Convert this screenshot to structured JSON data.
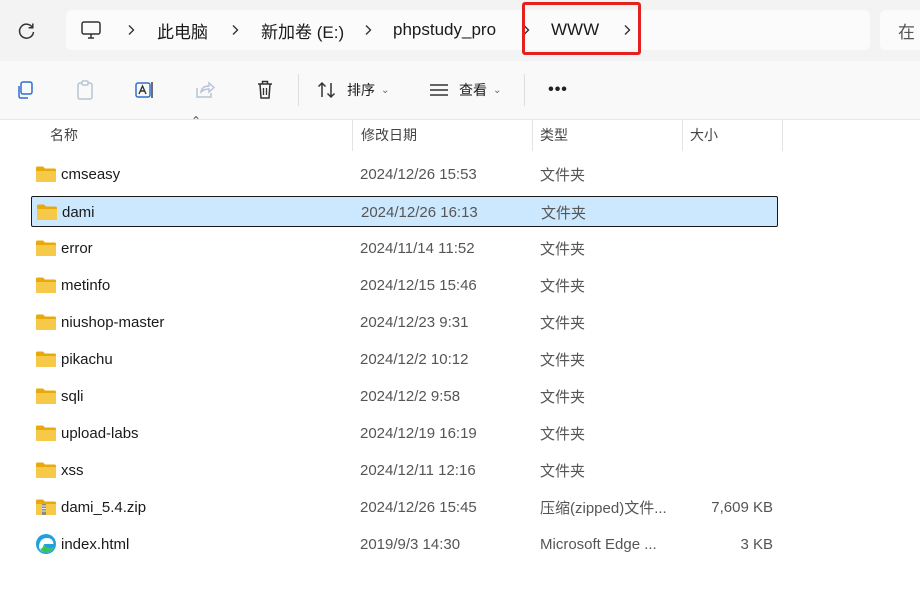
{
  "address_bar": {
    "breadcrumbs": [
      "此电脑",
      "新加卷 (E:)",
      "phpstudy_pro",
      "WWW"
    ],
    "search_placeholder": "在"
  },
  "toolbar": {
    "sort_label": "排序",
    "view_label": "查看",
    "more_label": "•••"
  },
  "columns": {
    "name": "名称",
    "date": "修改日期",
    "type": "类型",
    "size": "大小"
  },
  "files": [
    {
      "name": "cmseasy",
      "date": "2024/12/26 15:53",
      "type": "文件夹",
      "size": "",
      "icon": "folder-icon"
    },
    {
      "name": "dami",
      "date": "2024/12/26 16:13",
      "type": "文件夹",
      "size": "",
      "icon": "folder-icon",
      "selected": true
    },
    {
      "name": "error",
      "date": "2024/11/14 11:52",
      "type": "文件夹",
      "size": "",
      "icon": "folder-icon"
    },
    {
      "name": "metinfo",
      "date": "2024/12/15 15:46",
      "type": "文件夹",
      "size": "",
      "icon": "folder-icon"
    },
    {
      "name": "niushop-master",
      "date": "2024/12/23 9:31",
      "type": "文件夹",
      "size": "",
      "icon": "folder-icon"
    },
    {
      "name": "pikachu",
      "date": "2024/12/2 10:12",
      "type": "文件夹",
      "size": "",
      "icon": "folder-icon"
    },
    {
      "name": "sqli",
      "date": "2024/12/2 9:58",
      "type": "文件夹",
      "size": "",
      "icon": "folder-icon"
    },
    {
      "name": "upload-labs",
      "date": "2024/12/19 16:19",
      "type": "文件夹",
      "size": "",
      "icon": "folder-icon"
    },
    {
      "name": "xss",
      "date": "2024/12/11 12:16",
      "type": "文件夹",
      "size": "",
      "icon": "folder-icon"
    },
    {
      "name": "dami_5.4.zip",
      "date": "2024/12/26 15:45",
      "type": "压缩(zipped)文件...",
      "size": "7,609 KB",
      "icon": "zip-folder-icon"
    },
    {
      "name": "index.html",
      "date": "2019/9/3 14:30",
      "type": "Microsoft Edge ...",
      "size": "3 KB",
      "icon": "edge-icon"
    }
  ],
  "colors": {
    "folder_yellow": "#f7c948",
    "selection_bg": "#cce8ff",
    "highlight_red": "#e3211e",
    "toolbar_blue": "#2f6fd1"
  }
}
